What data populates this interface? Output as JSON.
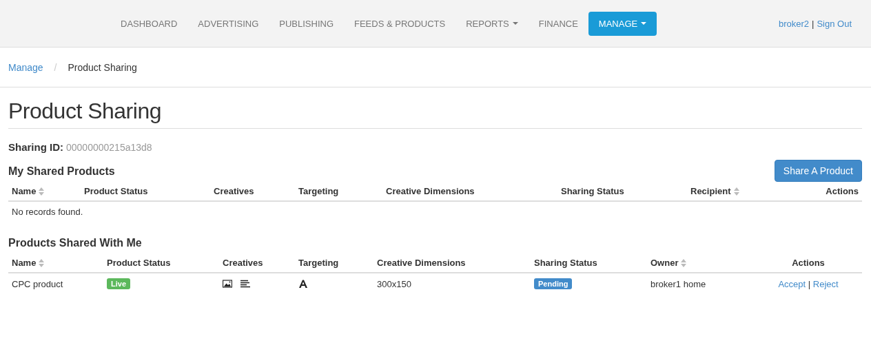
{
  "navbar": {
    "items": [
      {
        "label": "DASHBOARD",
        "selected": false,
        "dropdown": false
      },
      {
        "label": "ADVERTISING",
        "selected": false,
        "dropdown": false
      },
      {
        "label": "PUBLISHING",
        "selected": false,
        "dropdown": false
      },
      {
        "label": "FEEDS & PRODUCTS",
        "selected": false,
        "dropdown": false
      },
      {
        "label": "REPORTS",
        "selected": false,
        "dropdown": true
      },
      {
        "label": "FINANCE",
        "selected": false,
        "dropdown": false
      },
      {
        "label": "MANAGE",
        "selected": true,
        "dropdown": true
      }
    ],
    "user": "broker2",
    "separator": "|",
    "sign_out": "Sign Out"
  },
  "breadcrumb": [
    {
      "label": "Manage",
      "link": true
    },
    {
      "label": "Product Sharing",
      "link": false
    }
  ],
  "breadcrumb_separator": "/",
  "title": "Product Sharing",
  "sharing_id": {
    "label": "Sharing ID:",
    "value": "00000000215a13d8"
  },
  "my_shared": {
    "title": "My Shared Products",
    "button": "Share A Product",
    "columns": [
      {
        "label": "Name",
        "sortable": true
      },
      {
        "label": "Product Status",
        "sortable": false
      },
      {
        "label": "Creatives",
        "sortable": false
      },
      {
        "label": "Targeting",
        "sortable": false
      },
      {
        "label": "Creative Dimensions",
        "sortable": false
      },
      {
        "label": "Sharing Status",
        "sortable": false
      },
      {
        "label": "Recipient",
        "sortable": true
      },
      {
        "label": "Actions",
        "sortable": false
      }
    ],
    "empty": "No records found."
  },
  "shared_with_me": {
    "title": "Products Shared With Me",
    "columns": [
      {
        "label": "Name",
        "sortable": true
      },
      {
        "label": "Product Status",
        "sortable": false
      },
      {
        "label": "Creatives",
        "sortable": false
      },
      {
        "label": "Targeting",
        "sortable": false
      },
      {
        "label": "Creative Dimensions",
        "sortable": false
      },
      {
        "label": "Sharing Status",
        "sortable": false
      },
      {
        "label": "Owner",
        "sortable": true
      },
      {
        "label": "Actions",
        "sortable": false
      }
    ],
    "rows": [
      {
        "name": "CPC product",
        "product_status": {
          "label": "Live",
          "kind": "success"
        },
        "creatives": [
          {
            "kind": "image"
          },
          {
            "kind": "text"
          }
        ],
        "targeting": [
          {
            "kind": "font"
          }
        ],
        "dimensions": "300x150",
        "sharing_status": {
          "label": "Pending",
          "kind": "primary"
        },
        "owner": "broker1 home",
        "actions": [
          "Accept",
          "Reject"
        ],
        "action_separator": "|"
      }
    ]
  }
}
